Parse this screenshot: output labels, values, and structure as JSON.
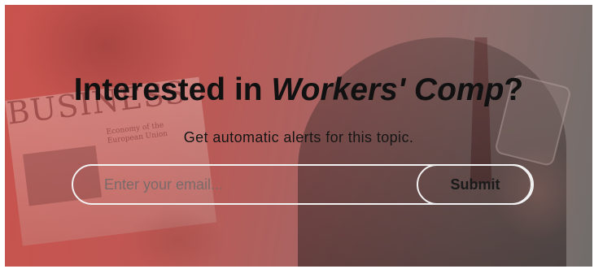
{
  "background": {
    "newspaper_title": "BUSINESS",
    "newspaper_subtitle": "Economy of the\nEuropean Union"
  },
  "headline": {
    "prefix": "Interested in ",
    "topic": "Workers' Comp",
    "suffix": "?"
  },
  "subline": "Get automatic alerts for this topic.",
  "form": {
    "email_placeholder": "Enter your email...",
    "email_value": "",
    "submit_label": "Submit"
  },
  "colors": {
    "overlay_red": "#c9534d",
    "overlay_gray": "#706d6b",
    "outline": "#f2f2f2",
    "text": "#111111"
  }
}
